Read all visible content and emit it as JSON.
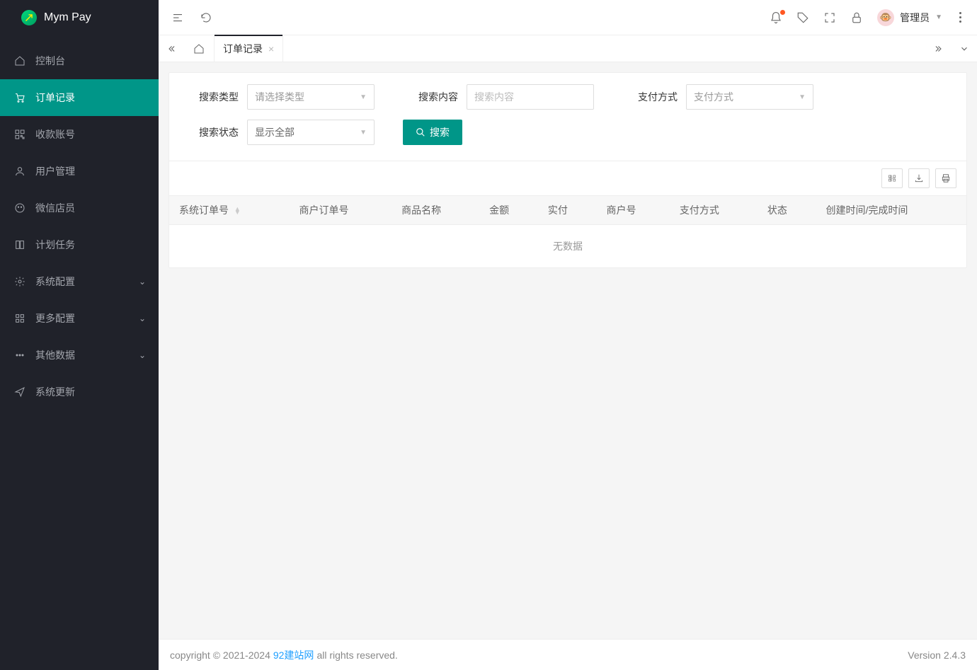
{
  "brand": {
    "name": "Mym Pay"
  },
  "sidebar": {
    "items": [
      {
        "label": "控制台",
        "icon": "home"
      },
      {
        "label": "订单记录",
        "icon": "cart",
        "active": true
      },
      {
        "label": "收款账号",
        "icon": "qr"
      },
      {
        "label": "用户管理",
        "icon": "user"
      },
      {
        "label": "微信店员",
        "icon": "wechat"
      },
      {
        "label": "计划任务",
        "icon": "book"
      },
      {
        "label": "系统配置",
        "icon": "gear",
        "expandable": true
      },
      {
        "label": "更多配置",
        "icon": "grid",
        "expandable": true
      },
      {
        "label": "其他数据",
        "icon": "dots",
        "expandable": true
      },
      {
        "label": "系统更新",
        "icon": "send"
      }
    ]
  },
  "header": {
    "user_name": "管理员"
  },
  "tabs": {
    "items": [
      {
        "label": "订单记录",
        "active": true
      }
    ]
  },
  "search": {
    "type_label": "搜索类型",
    "type_placeholder": "请选择类型",
    "content_label": "搜索内容",
    "content_placeholder": "搜索内容",
    "pay_label": "支付方式",
    "pay_placeholder": "支付方式",
    "status_label": "搜索状态",
    "status_placeholder": "显示全部",
    "button": "搜索"
  },
  "table": {
    "columns": [
      "系统订单号",
      "商户订单号",
      "商品名称",
      "金额",
      "实付",
      "商户号",
      "支付方式",
      "状态",
      "创建时间/完成时间"
    ],
    "empty_text": "无数据"
  },
  "footer": {
    "copyright_prefix": "copyright © 2021-2024",
    "link_text": "92建站网",
    "copyright_suffix": "all rights reserved.",
    "version": "Version 2.4.3"
  }
}
